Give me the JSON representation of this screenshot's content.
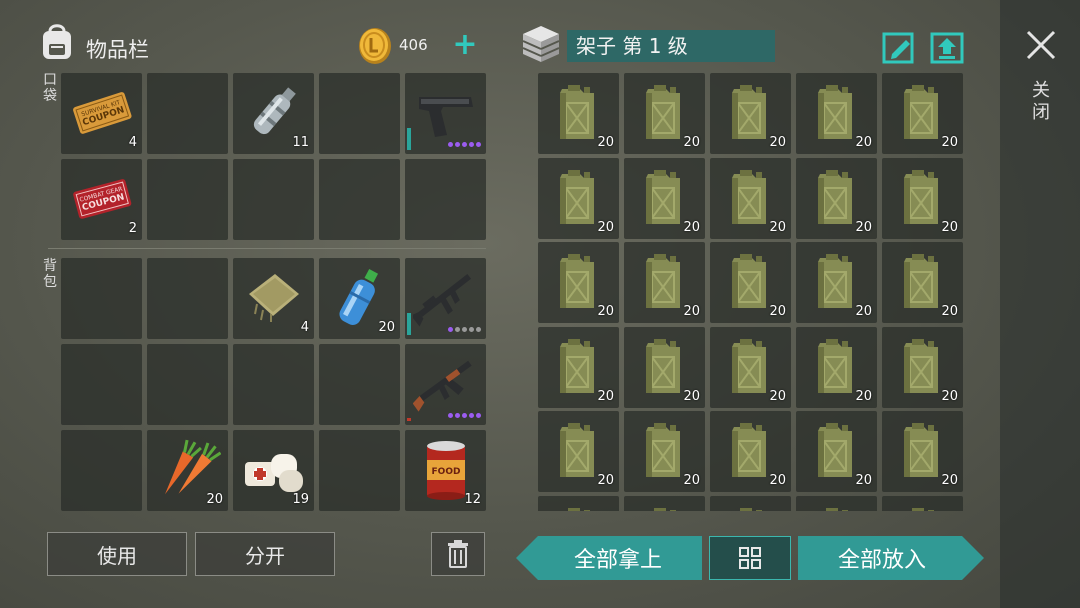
{
  "inventory": {
    "title": "物品栏",
    "coins": "406",
    "add_icon": "+",
    "pocket_label": "口袋",
    "backpack_label": "背包",
    "pocket_slots": [
      {
        "item": "survival-coupon-icon",
        "qty": "4"
      },
      {
        "item": null,
        "qty": ""
      },
      {
        "item": "plastic-bottle-icon",
        "qty": "11"
      },
      {
        "item": null,
        "qty": ""
      },
      {
        "item": "pistol-icon",
        "qty": "",
        "durability": true,
        "dots": [
          "#9b5cf0",
          "#9b5cf0",
          "#9b5cf0",
          "#9b5cf0",
          "#9b5cf0"
        ]
      },
      {
        "item": "combat-coupon-icon",
        "qty": "2"
      },
      {
        "item": null,
        "qty": ""
      },
      {
        "item": null,
        "qty": ""
      },
      {
        "item": null,
        "qty": ""
      },
      {
        "item": null,
        "qty": ""
      }
    ],
    "backpack_slots": [
      {
        "item": null,
        "qty": ""
      },
      {
        "item": null,
        "qty": ""
      },
      {
        "item": "cloth-icon",
        "qty": "4"
      },
      {
        "item": "water-bottle-icon",
        "qty": "20"
      },
      {
        "item": "assault-rifle-icon",
        "qty": "",
        "durability": true,
        "dots": [
          "#9b5cf0",
          "#9a9a9a",
          "#9a9a9a",
          "#9a9a9a",
          "#9a9a9a"
        ]
      },
      {
        "item": null,
        "qty": ""
      },
      {
        "item": null,
        "qty": ""
      },
      {
        "item": null,
        "qty": ""
      },
      {
        "item": null,
        "qty": ""
      },
      {
        "item": "ak-rifle-icon",
        "qty": "",
        "durability_low": true,
        "dots": [
          "#9b5cf0",
          "#9b5cf0",
          "#9b5cf0",
          "#9b5cf0",
          "#9b5cf0"
        ]
      },
      {
        "item": null,
        "qty": ""
      },
      {
        "item": "carrot-icon",
        "qty": "20"
      },
      {
        "item": "bandage-icon",
        "qty": "19"
      },
      {
        "item": null,
        "qty": ""
      },
      {
        "item": "canned-food-icon",
        "qty": "12"
      }
    ],
    "use_label": "使用",
    "split_label": "分开"
  },
  "container": {
    "title": "架子 第 1 级",
    "item_icon": "jerrycan-icon",
    "item_qty": "20",
    "take_all_label": "全部拿上",
    "put_all_label": "全部放入"
  },
  "close_label": "关闭",
  "colors": {
    "accent": "#31c9bd",
    "teal_button": "#319a95",
    "rarity_purple": "#9b5cf0"
  }
}
